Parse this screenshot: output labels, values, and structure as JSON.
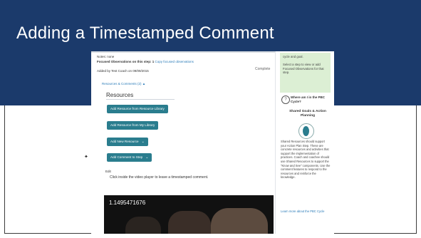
{
  "slide": {
    "title": "Adding a Timestamped Comment",
    "colors": {
      "band": "#1b3a6b",
      "button": "#2a7d8e",
      "sidebar_green": "#dcefd4",
      "link": "#2a7bb8"
    }
  },
  "page": {
    "notes": "Notes: none",
    "focused_label": "Focused Observations on this step: 1",
    "focused_link": "Copy focused observations",
    "added_by": "Added by Test Coach on 09/09/2015",
    "status": "Complete",
    "resources_link": "Resources & Comments (2) ▲",
    "resources_heading": "Resources",
    "buttons": {
      "add_from_library": "Add Resource from Resource Library",
      "add_from_my_library": "Add Resource from My Library",
      "add_new": "Add New Resource",
      "add_comment": "Add Comment to Step"
    },
    "edit_label": "Edit",
    "hint": "Click inside the video player to leave a timestamped comment.",
    "video_title": "1.1495471676"
  },
  "sidebar": {
    "top_line": "cycle and goal.",
    "select_text": "Select a step to view or add Focused Observations for that step.",
    "where_title": "Where am I in the PBC Cycle?",
    "goal_title": "Shared Goals & Action Planning",
    "description": "Shared Resources should support your Action Plan Step. These are concrete resources and activities that support the implementation of practices. Coach and coachee should use Shared Resources to support the \"Know and See\" components. Use the comment features to respond to the resources and reinforce the knowledge.",
    "learn_more": "Learn more about the PBC Cycle"
  },
  "icons": {
    "help": "question-circle-icon",
    "cycle": "cycle-progress-icon",
    "chevron": "chevron-down-icon",
    "pointer": "mouse-cursor-icon"
  }
}
